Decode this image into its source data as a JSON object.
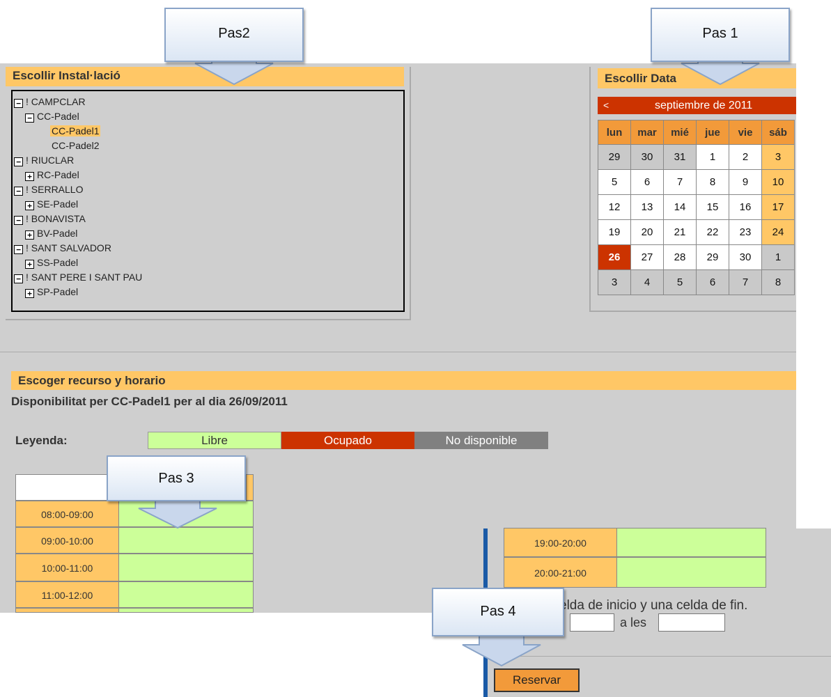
{
  "callouts": {
    "pas1": "Pas 1",
    "pas2": "Pas2",
    "pas3": "Pas 3",
    "pas4": "Pas 4"
  },
  "installation": {
    "title": "Escollir Instal·lació",
    "tree": [
      {
        "toggle": "−",
        "label": "! CAMPCLAR"
      },
      {
        "toggle": "−",
        "label": "CC-Padel"
      },
      {
        "toggle": "",
        "label": "CC-Padel1"
      },
      {
        "toggle": "",
        "label": "CC-Padel2"
      },
      {
        "toggle": "−",
        "label": "! RIUCLAR"
      },
      {
        "toggle": "+",
        "label": "RC-Padel"
      },
      {
        "toggle": "−",
        "label": "! SERRALLO"
      },
      {
        "toggle": "+",
        "label": "SE-Padel"
      },
      {
        "toggle": "−",
        "label": "! BONAVISTA"
      },
      {
        "toggle": "+",
        "label": "BV-Padel"
      },
      {
        "toggle": "−",
        "label": "! SANT SALVADOR"
      },
      {
        "toggle": "+",
        "label": "SS-Padel"
      },
      {
        "toggle": "−",
        "label": "! SANT PERE I SANT PAU"
      },
      {
        "toggle": "+",
        "label": "SP-Padel"
      }
    ]
  },
  "calendar": {
    "title": "Escollir Data",
    "prev": "<",
    "month": "septiembre de 2011",
    "weekdays": [
      "lun",
      "mar",
      "mié",
      "jue",
      "vie",
      "sáb"
    ],
    "weeks": [
      [
        "29",
        "30",
        "31",
        "1",
        "2",
        "3"
      ],
      [
        "5",
        "6",
        "7",
        "8",
        "9",
        "10"
      ],
      [
        "12",
        "13",
        "14",
        "15",
        "16",
        "17"
      ],
      [
        "19",
        "20",
        "21",
        "22",
        "23",
        "24"
      ],
      [
        "26",
        "27",
        "28",
        "29",
        "30",
        "1"
      ],
      [
        "3",
        "4",
        "5",
        "6",
        "7",
        "8"
      ]
    ],
    "selected": "26"
  },
  "resource": {
    "title": "Escoger recurso y horario",
    "availability": "Disponibilitat per CC-Padel1 per al dia 26/09/2011",
    "legend_label": "Leyenda:",
    "legend": [
      {
        "label": "Libre",
        "color": "#ccff99",
        "text": "#333333"
      },
      {
        "label": "Ocupado",
        "color": "#cc3300",
        "text": "#ffffff"
      },
      {
        "label": "No disponible",
        "color": "#808080",
        "text": "#ffffff"
      }
    ],
    "slots_left": [
      "08:00-09:00",
      "09:00-10:00",
      "10:00-11:00",
      "11:00-12:00"
    ],
    "slots_right": [
      "19:00-20:00",
      "20:00-21:00"
    ]
  },
  "booking": {
    "instruction": "elda de inicio y una celda de fin.",
    "to_label": "a les",
    "reserve": "Reservar"
  }
}
